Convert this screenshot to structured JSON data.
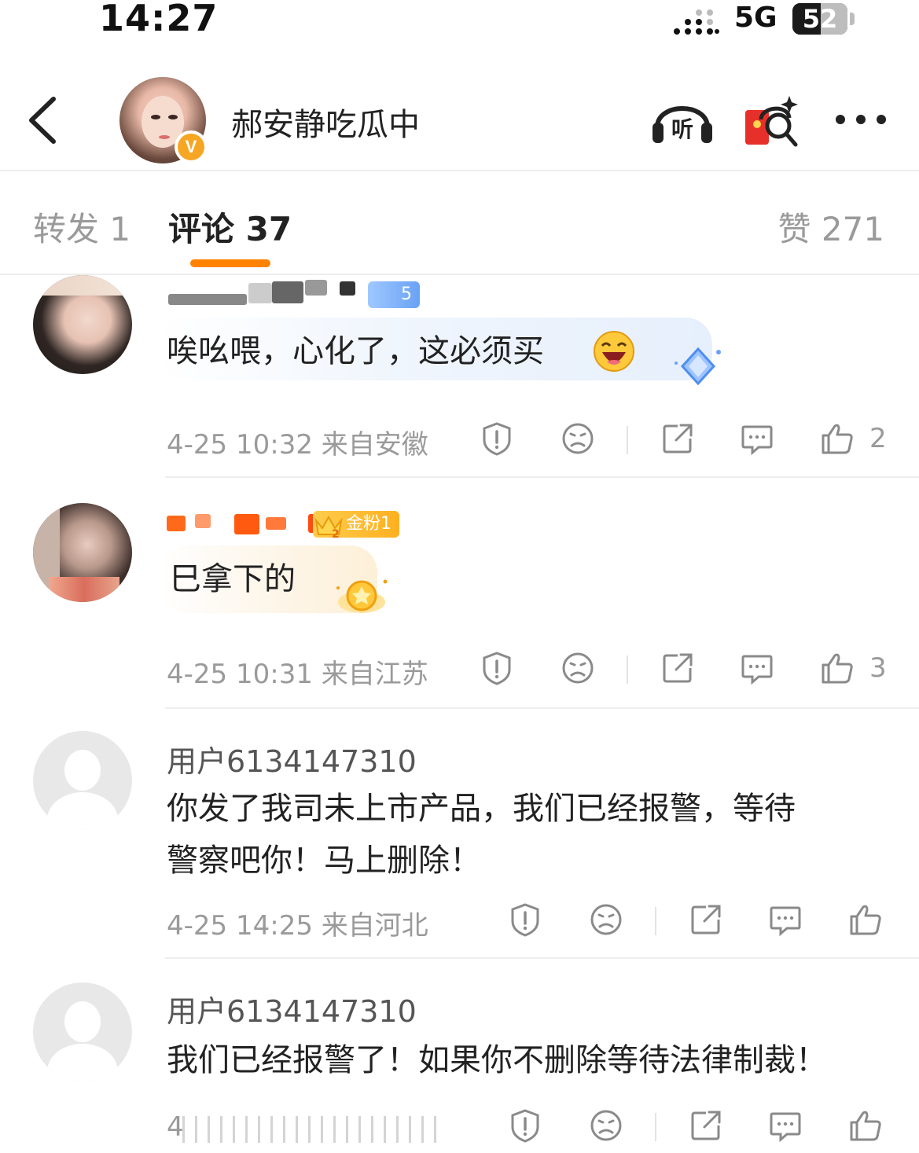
{
  "status_bar": {
    "time": "14:27",
    "network": "5G",
    "battery": "52",
    "battery_level": 0.52
  },
  "header": {
    "author_name": "郝安静吃瓜中",
    "verified_badge": "V",
    "listen_label": "听",
    "icons": [
      "back-icon",
      "headphone-listen-icon",
      "red-packet-search-icon",
      "more-icon"
    ]
  },
  "tabs": {
    "repost": "转发 1",
    "comment": "评论 37",
    "like": "赞 271"
  },
  "colors": {
    "accent": "#ff8200",
    "gold_badge": "#ffb020",
    "blue_badge": "#6aa2f5"
  },
  "comments": [
    {
      "fan_badge": "5",
      "text": "唉吆喂，心化了，这必须买",
      "emoji": "laughing-face",
      "meta": "4-25 10:32 来自安徽",
      "likes": "2"
    },
    {
      "fan_badge": "金粉1",
      "crown_level": "2",
      "text": "巳拿下的",
      "meta": "4-25 10:31 来自江苏",
      "likes": "3"
    },
    {
      "name": "用户6134147310",
      "text_line1": "你发了我司未上市产品，我们已经报警，等待",
      "text_line2": "警察吧你！马上删除！",
      "meta": "4-25 14:25 来自河北",
      "likes": ""
    },
    {
      "name": "用户6134147310",
      "text": "我们已经报警了！如果你不删除等待法律制裁！",
      "meta": "4",
      "likes": ""
    }
  ]
}
